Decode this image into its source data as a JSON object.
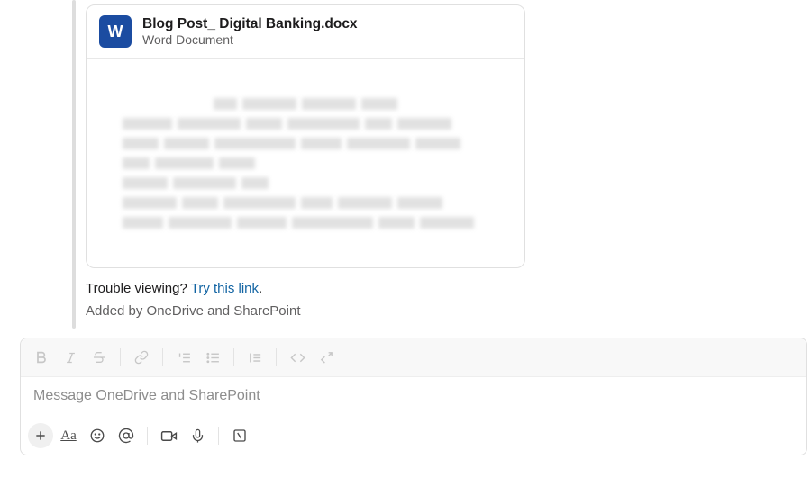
{
  "attachment": {
    "icon_letter": "W",
    "filename": "Blog Post_ Digital Banking.docx",
    "filetype": "Word Document"
  },
  "helper": {
    "prefix": "Trouble viewing? ",
    "link_text": "Try this link",
    "suffix": "."
  },
  "added_by": "Added by OneDrive and SharePoint",
  "composer": {
    "placeholder": "Message OneDrive and SharePoint"
  }
}
